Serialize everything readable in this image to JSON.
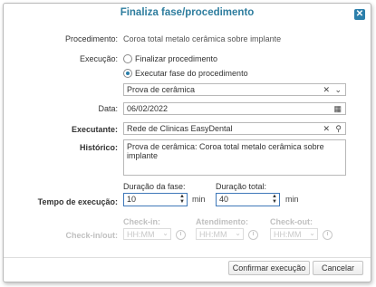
{
  "dialog": {
    "title": "Finaliza fase/procedimento",
    "close_icon": "close-icon"
  },
  "procedimento": {
    "label": "Procedimento:",
    "value": "Coroa total metalo cerâmica sobre implante"
  },
  "execucao": {
    "label": "Execução:",
    "options": [
      {
        "label": "Finalizar procedimento",
        "checked": false
      },
      {
        "label": "Executar fase do procedimento",
        "checked": true
      }
    ]
  },
  "fase_select": {
    "value": "Prova de cerâmica",
    "clear_icon": "clear-icon",
    "dropdown_icon": "chevron-down-icon"
  },
  "data": {
    "label": "Data:",
    "value": "06/02/2022",
    "icon": "calendar-icon"
  },
  "executante": {
    "label": "Executante:",
    "value": "Rede de Clinicas EasyDental",
    "clear_icon": "clear-icon",
    "search_icon": "search-icon"
  },
  "historico": {
    "label": "Histórico:",
    "value": "Prova de cerâmica: Coroa total metalo cerâmica sobre implante"
  },
  "tempo": {
    "label": "Tempo de execução:",
    "fase_label": "Duração da fase:",
    "fase_value": "10",
    "total_label": "Duração total:",
    "total_value": "40",
    "unit": "min"
  },
  "checkin": {
    "label": "Check-in/out:",
    "checkin_label": "Check-in:",
    "atendimento_label": "Atendimento:",
    "checkout_label": "Check-out:",
    "placeholder": "HH:MM"
  },
  "buttons": {
    "confirm": "Confirmar execução",
    "cancel": "Cancelar"
  }
}
